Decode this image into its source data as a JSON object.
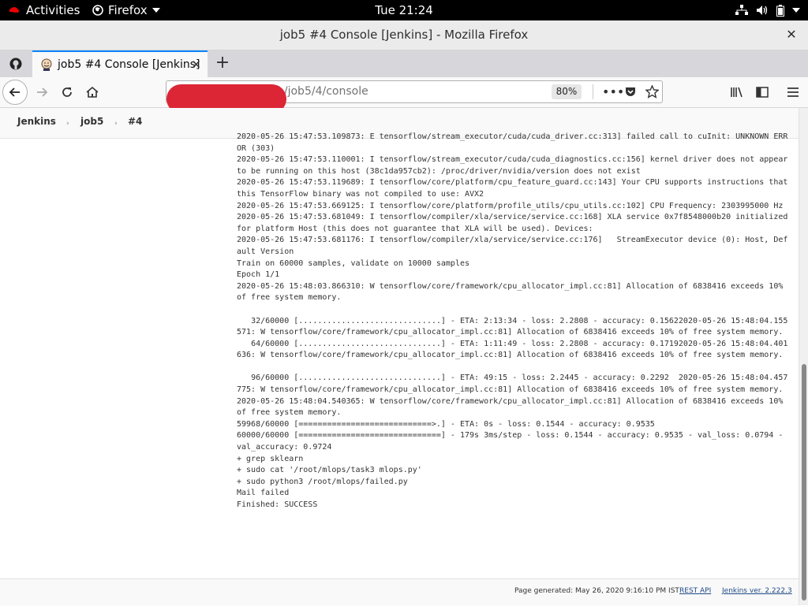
{
  "topbar": {
    "activities": "Activities",
    "app_menu": "Firefox",
    "clock": "Tue 21:24"
  },
  "window": {
    "title": "job5 #4 Console [Jenkins] - Mozilla Firefox"
  },
  "tabs": [
    {
      "label": "job5 #4 Console [Jenkins]",
      "active": true
    }
  ],
  "navbar": {
    "url": "b/job5/4/console",
    "zoom": "80%"
  },
  "breadcrumbs": [
    "Jenkins",
    "job5",
    "#4"
  ],
  "console": {
    "lines": [
      "2020-05-26 15:47:53.109873: E tensorflow/stream_executor/cuda/cuda_driver.cc:313] failed call to cuInit: UNKNOWN ERROR (303)",
      "2020-05-26 15:47:53.110001: I tensorflow/stream_executor/cuda/cuda_diagnostics.cc:156] kernel driver does not appear to be running on this host (38c1da957cb2): /proc/driver/nvidia/version does not exist",
      "2020-05-26 15:47:53.119689: I tensorflow/core/platform/cpu_feature_guard.cc:143] Your CPU supports instructions that this TensorFlow binary was not compiled to use: AVX2",
      "2020-05-26 15:47:53.669125: I tensorflow/core/platform/profile_utils/cpu_utils.cc:102] CPU Frequency: 2303995000 Hz",
      "2020-05-26 15:47:53.681049: I tensorflow/compiler/xla/service/service.cc:168] XLA service 0x7f8548000b20 initialized for platform Host (this does not guarantee that XLA will be used). Devices:",
      "2020-05-26 15:47:53.681176: I tensorflow/compiler/xla/service/service.cc:176]   StreamExecutor device (0): Host, Default Version",
      "Train on 60000 samples, validate on 10000 samples",
      "Epoch 1/1",
      "2020-05-26 15:48:03.866310: W tensorflow/core/framework/cpu_allocator_impl.cc:81] Allocation of 6838416 exceeds 10% of free system memory.",
      "",
      "   32/60000 [..............................] - ETA: 2:13:34 - loss: 2.2808 - accuracy: 0.15622020-05-26 15:48:04.155571: W tensorflow/core/framework/cpu_allocator_impl.cc:81] Allocation of 6838416 exceeds 10% of free system memory.",
      "   64/60000 [..............................] - ETA: 1:11:49 - loss: 2.2808 - accuracy: 0.17192020-05-26 15:48:04.401636: W tensorflow/core/framework/cpu_allocator_impl.cc:81] Allocation of 6838416 exceeds 10% of free system memory.",
      "",
      "   96/60000 [..............................] - ETA: 49:15 - loss: 2.2445 - accuracy: 0.2292  2020-05-26 15:48:04.457775: W tensorflow/core/framework/cpu_allocator_impl.cc:81] Allocation of 6838416 exceeds 10% of free system memory.",
      "2020-05-26 15:48:04.540365: W tensorflow/core/framework/cpu_allocator_impl.cc:81] Allocation of 6838416 exceeds 10% of free system memory.",
      "59968/60000 [============================>.] - ETA: 0s - loss: 0.1544 - accuracy: 0.9535",
      "60000/60000 [==============================] - 179s 3ms/step - loss: 0.1544 - accuracy: 0.9535 - val_loss: 0.0794 - val_accuracy: 0.9724",
      "+ grep sklearn",
      "+ sudo cat '/root/mlops/task3 mlops.py'",
      "+ sudo python3 /root/mlops/failed.py",
      "Mail failed",
      "Finished: SUCCESS"
    ]
  },
  "footer": {
    "generated": "Page generated: May 26, 2020 9:16:10 PM IST",
    "rest_api": "REST API",
    "version": "Jenkins ver. 2.222.3"
  },
  "colors": {
    "accent_tab": "#0a84ff",
    "redaction": "#dc2535",
    "link": "#204a87"
  }
}
